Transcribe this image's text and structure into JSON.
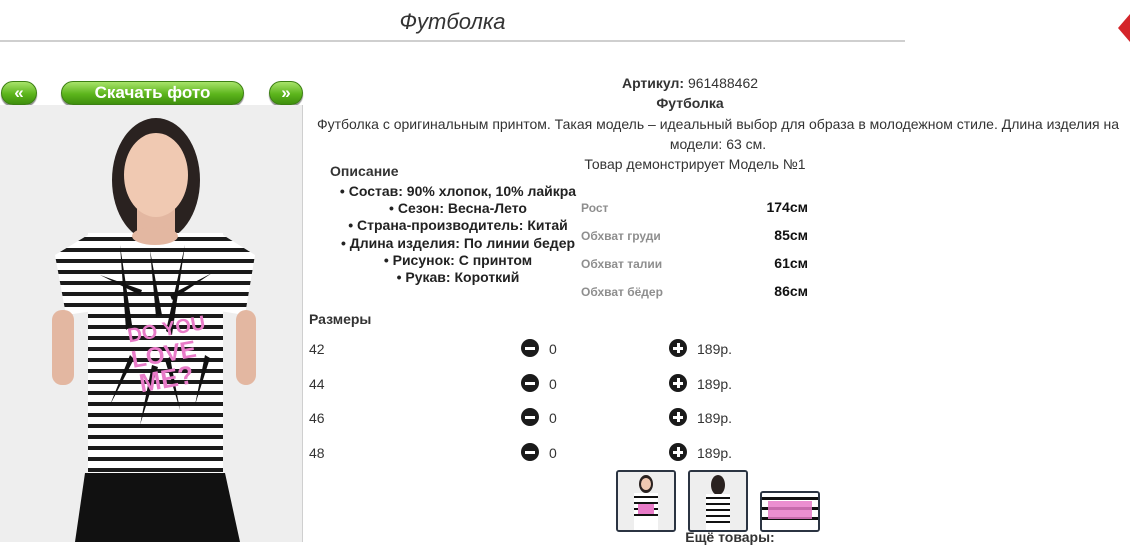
{
  "page": {
    "title": "Футболка"
  },
  "nav": {
    "prev_label": "«",
    "next_label": "»",
    "download_label": "Скачать фото"
  },
  "product": {
    "sku_label": "Артикул:",
    "sku": "961488462",
    "name": "Футболка",
    "description": "Футболка с оригинальным принтом. Такая модель – идеальный выбор для образа в молодежном стиле. Длина изделия на модели: 63 см.",
    "model_note": "Товар демонстрирует Модель №1"
  },
  "description_section": {
    "title": "Описание",
    "items": [
      "Состав: 90% хлопок, 10% лайкра",
      "Сезон: Весна-Лето",
      "Страна-производитель: Китай",
      "Длина изделия: По линии бедер",
      "Рисунок: С принтом",
      "Рукав: Короткий"
    ]
  },
  "measurements": [
    {
      "label": "Рост",
      "value": "174см"
    },
    {
      "label": "Обхват груди",
      "value": "85см"
    },
    {
      "label": "Обхват талии",
      "value": "61см"
    },
    {
      "label": "Обхват бёдер",
      "value": "86см"
    }
  ],
  "sizes": {
    "title": "Размеры",
    "rows": [
      {
        "size": "42",
        "qty": "0",
        "price": "189р."
      },
      {
        "size": "44",
        "qty": "0",
        "price": "189р."
      },
      {
        "size": "46",
        "qty": "0",
        "price": "189р."
      },
      {
        "size": "48",
        "qty": "0",
        "price": "189р."
      }
    ]
  },
  "more_goods_label": "Ещё товары:",
  "colors": {
    "button_green": "#5cb51c",
    "print_pink": "#e87bc8",
    "corner_red": "#d4252a"
  }
}
